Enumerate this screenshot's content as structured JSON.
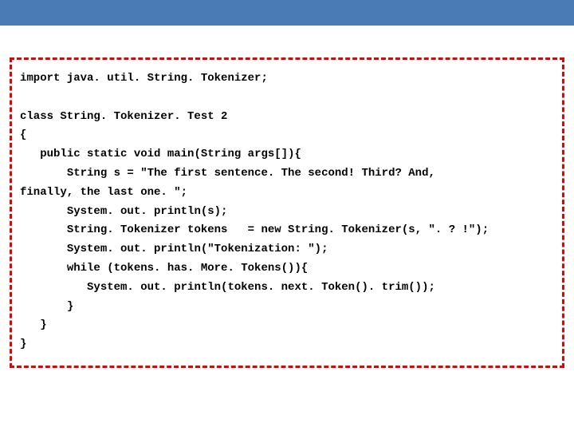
{
  "code": {
    "lines": [
      "import java. util. String. Tokenizer;",
      "",
      "class String. Tokenizer. Test 2",
      "{",
      "   public static void main(String args[]){",
      "       String s = \"The first sentence. The second! Third? And,",
      "finally, the last one. \";",
      "       System. out. println(s);",
      "       String. Tokenizer tokens   = new String. Tokenizer(s, \". ? !\");",
      "       System. out. println(\"Tokenization: \");",
      "       while (tokens. has. More. Tokens()){",
      "          System. out. println(tokens. next. Token(). trim());",
      "       }",
      "   }",
      "}"
    ]
  }
}
